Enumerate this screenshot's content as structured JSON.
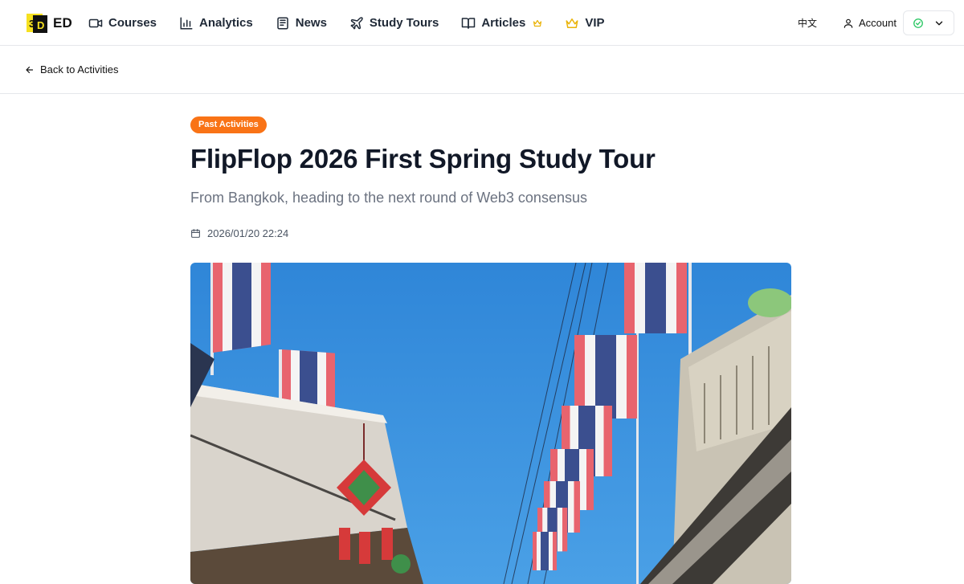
{
  "nav": {
    "logo_text": "ED",
    "links": [
      {
        "label": "Courses",
        "icon": "video-icon"
      },
      {
        "label": "Analytics",
        "icon": "bar-chart-icon"
      },
      {
        "label": "News",
        "icon": "newspaper-icon"
      },
      {
        "label": "Study Tours",
        "icon": "plane-icon"
      },
      {
        "label": "Articles",
        "icon": "book-open-icon"
      },
      {
        "label": "VIP",
        "icon": "crown-icon"
      }
    ],
    "language": "中文",
    "account_label": "Account",
    "accent_color": "#22c55e",
    "crown_color": "#eab308"
  },
  "back_link": {
    "label": "Back to Activities"
  },
  "article": {
    "badge": "Past Activities",
    "badge_color": "#f97316",
    "title": "FlipFlop 2026 First Spring Study Tour",
    "subtitle": "From Bangkok, heading to the next round of Web3 consensus",
    "date": "2026/01/20 22:24"
  }
}
